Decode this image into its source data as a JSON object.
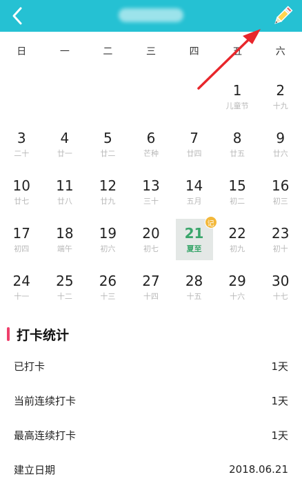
{
  "header": {
    "back_icon": "chevron-left-icon",
    "edit_icon": "pencil-icon",
    "accent": "#25c1d3"
  },
  "weekdays": [
    "日",
    "一",
    "二",
    "三",
    "四",
    "五",
    "六"
  ],
  "calendar": {
    "cells": [
      {
        "day": "",
        "lunar": ""
      },
      {
        "day": "",
        "lunar": ""
      },
      {
        "day": "",
        "lunar": ""
      },
      {
        "day": "",
        "lunar": ""
      },
      {
        "day": "",
        "lunar": ""
      },
      {
        "day": "1",
        "lunar": "儿童节"
      },
      {
        "day": "2",
        "lunar": "十九"
      },
      {
        "day": "3",
        "lunar": "二十"
      },
      {
        "day": "4",
        "lunar": "廿一"
      },
      {
        "day": "5",
        "lunar": "廿二"
      },
      {
        "day": "6",
        "lunar": "芒种"
      },
      {
        "day": "7",
        "lunar": "廿四"
      },
      {
        "day": "8",
        "lunar": "廿五"
      },
      {
        "day": "9",
        "lunar": "廿六"
      },
      {
        "day": "10",
        "lunar": "廿七"
      },
      {
        "day": "11",
        "lunar": "廿八"
      },
      {
        "day": "12",
        "lunar": "廿九"
      },
      {
        "day": "13",
        "lunar": "三十"
      },
      {
        "day": "14",
        "lunar": "五月"
      },
      {
        "day": "15",
        "lunar": "初二"
      },
      {
        "day": "16",
        "lunar": "初三"
      },
      {
        "day": "17",
        "lunar": "初四"
      },
      {
        "day": "18",
        "lunar": "端午"
      },
      {
        "day": "19",
        "lunar": "初六"
      },
      {
        "day": "20",
        "lunar": "初七"
      },
      {
        "day": "21",
        "lunar": "夏至",
        "selected": true,
        "badge": "记"
      },
      {
        "day": "22",
        "lunar": "初九"
      },
      {
        "day": "23",
        "lunar": "初十"
      },
      {
        "day": "24",
        "lunar": "十一"
      },
      {
        "day": "25",
        "lunar": "十二"
      },
      {
        "day": "26",
        "lunar": "十三"
      },
      {
        "day": "27",
        "lunar": "十四"
      },
      {
        "day": "28",
        "lunar": "十五"
      },
      {
        "day": "29",
        "lunar": "十六"
      },
      {
        "day": "30",
        "lunar": "十七"
      }
    ]
  },
  "stats": {
    "title": "打卡统计",
    "rows": [
      {
        "label": "已打卡",
        "value": "1天"
      },
      {
        "label": "当前连续打卡",
        "value": "1天"
      },
      {
        "label": "最高连续打卡",
        "value": "1天"
      },
      {
        "label": "建立日期",
        "value": "2018.06.21"
      }
    ]
  }
}
